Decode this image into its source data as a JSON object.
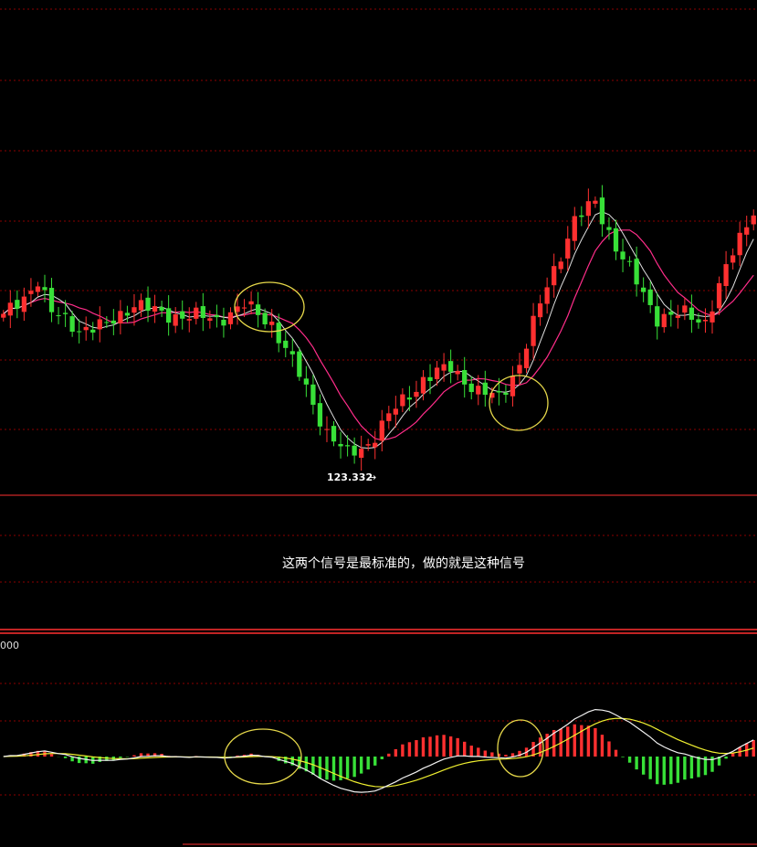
{
  "annotation_text": "这两个信号是最标准的，做的就是这种信号",
  "macd_scale_label": "000",
  "low_marker": {
    "label": "123.332",
    "arrow": "→"
  },
  "colors": {
    "background": "#000000",
    "grid": "#8b0000",
    "divider": "#ff3030",
    "up_bar": "#ff3030",
    "down_bar": "#38e038",
    "ma_fast": "#e0e0e0",
    "ma_slow": "#ff2d8a",
    "dif_line": "#f2f2f2",
    "dea_line": "#f0f030",
    "signal_circle": "#e6d84a",
    "text": "#ffffff"
  },
  "chart_data": [
    {
      "type": "candlestick",
      "name": "price",
      "annotations": [
        "123.332"
      ],
      "circled_signals": [
        2,
        5
      ],
      "keypoints": [
        {
          "t": 0,
          "v": 134.5
        },
        {
          "t": 3,
          "v": 136.0
        },
        {
          "t": 5,
          "v": 137.5
        },
        {
          "t": 7,
          "v": 134.8
        },
        {
          "t": 11,
          "v": 133.6
        },
        {
          "t": 15,
          "v": 133.8
        },
        {
          "t": 19,
          "v": 135.6
        },
        {
          "t": 23,
          "v": 134.7
        },
        {
          "t": 27,
          "v": 134.6
        },
        {
          "t": 31,
          "v": 134.3
        },
        {
          "t": 35,
          "v": 135.4
        },
        {
          "t": 39,
          "v": 134.0
        },
        {
          "t": 43,
          "v": 130.0
        },
        {
          "t": 47,
          "v": 125.5
        },
        {
          "t": 50,
          "v": 123.7
        },
        {
          "t": 53,
          "v": 124.6
        },
        {
          "t": 57,
          "v": 127.4
        },
        {
          "t": 61,
          "v": 129.6
        },
        {
          "t": 65,
          "v": 130.6
        },
        {
          "t": 69,
          "v": 128.6
        },
        {
          "t": 72,
          "v": 128.2
        },
        {
          "t": 75,
          "v": 130.8
        },
        {
          "t": 79,
          "v": 137.0
        },
        {
          "t": 83,
          "v": 142.0
        },
        {
          "t": 86,
          "v": 143.5
        },
        {
          "t": 89,
          "v": 140.0
        },
        {
          "t": 92,
          "v": 137.2
        },
        {
          "t": 95,
          "v": 134.5
        },
        {
          "t": 99,
          "v": 134.7
        },
        {
          "t": 102,
          "v": 134.2
        },
        {
          "t": 106,
          "v": 139.5
        },
        {
          "t": 109,
          "v": 143.0
        }
      ]
    },
    {
      "type": "bar+line",
      "name": "macd",
      "circled_signals": [
        2,
        5
      ]
    }
  ]
}
